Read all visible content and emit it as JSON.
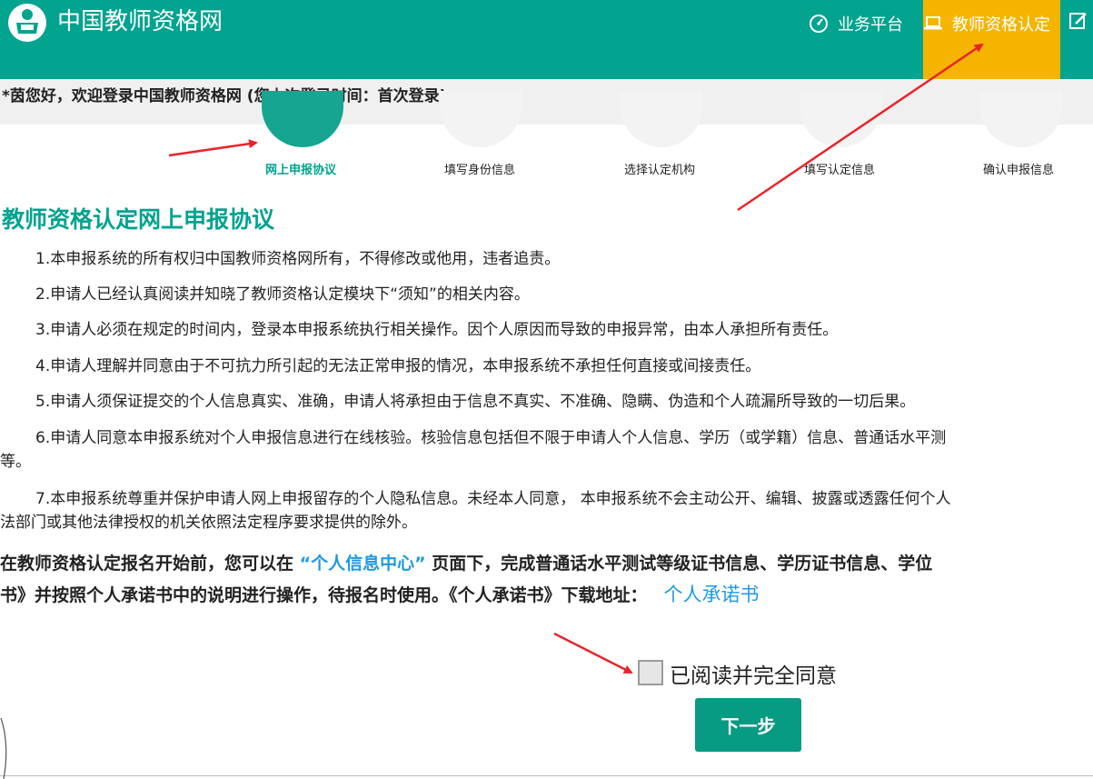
{
  "header": {
    "site_title": "中国教师资格网",
    "nav": {
      "business_platform": "业务平台",
      "teacher_certification": "教师资格认定"
    }
  },
  "welcome": "*茵您好，欢迎登录中国教师资格网 (您上次登录时间：首次登录)",
  "steps": [
    {
      "label": "网上申报协议",
      "active": true
    },
    {
      "label": "填写身份信息",
      "active": false
    },
    {
      "label": "选择认定机构",
      "active": false
    },
    {
      "label": "填写认定信息",
      "active": false
    },
    {
      "label": "确认申报信息",
      "active": false
    }
  ],
  "agreement": {
    "title": "教师资格认定网上申报协议",
    "clauses": [
      {
        "lines": [
          "1.本申报系统的所有权归中国教师资格网所有，不得修改或他用，违者追责。"
        ]
      },
      {
        "lines": [
          "2.申请人已经认真阅读并知晓了教师资格认定模块下“须知”的相关内容。"
        ]
      },
      {
        "lines": [
          "3.申请人必须在规定的时间内，登录本申报系统执行相关操作。因个人原因而导致的申报异常，由本人承担所有责任。"
        ]
      },
      {
        "lines": [
          "4.申请人理解并同意由于不可抗力所引起的无法正常申报的情况，本申报系统不承担任何直接或间接责任。"
        ]
      },
      {
        "lines": [
          "5.申请人须保证提交的个人信息真实、准确，申请人将承担由于信息不真实、不准确、隐瞒、伪造和个人疏漏所导致的一切后果。"
        ]
      },
      {
        "lines": [
          "6.申请人同意本申报系统对个人申报信息进行在线核验。核验信息包括但不限于申请人个人信息、学历（或学籍）信息、普通话水平测",
          "等。"
        ]
      },
      {
        "lines": [
          "7.本申报系统尊重并保护申请人网上申报留存的个人隐私信息。未经本人同意， 本申报系统不会主动公开、编辑、披露或透露任何个人",
          "法部门或其他法律授权的机关依照法定程序要求提供的除外。"
        ]
      }
    ]
  },
  "notice": {
    "part1": "在教师资格认定报名开始前，您可以在 ",
    "highlight": "“个人信息中心”",
    "part2": " 页面下，完成普通话水平测试等级证书信息、学历证书信息、学位",
    "line2": "书》并按照个人承诺书中的说明进行操作，待报名时使用。《个人承诺书》下载地址：",
    "link_label": "个人承诺书"
  },
  "consent": {
    "label": "已阅读并完全同意",
    "checked": false
  },
  "next_button": "下一步",
  "colors": {
    "header": "#02a38f",
    "active_nav": "#f5b400",
    "link": "#1e9ae0",
    "button": "#089b83",
    "arrow": "#e8242a"
  }
}
